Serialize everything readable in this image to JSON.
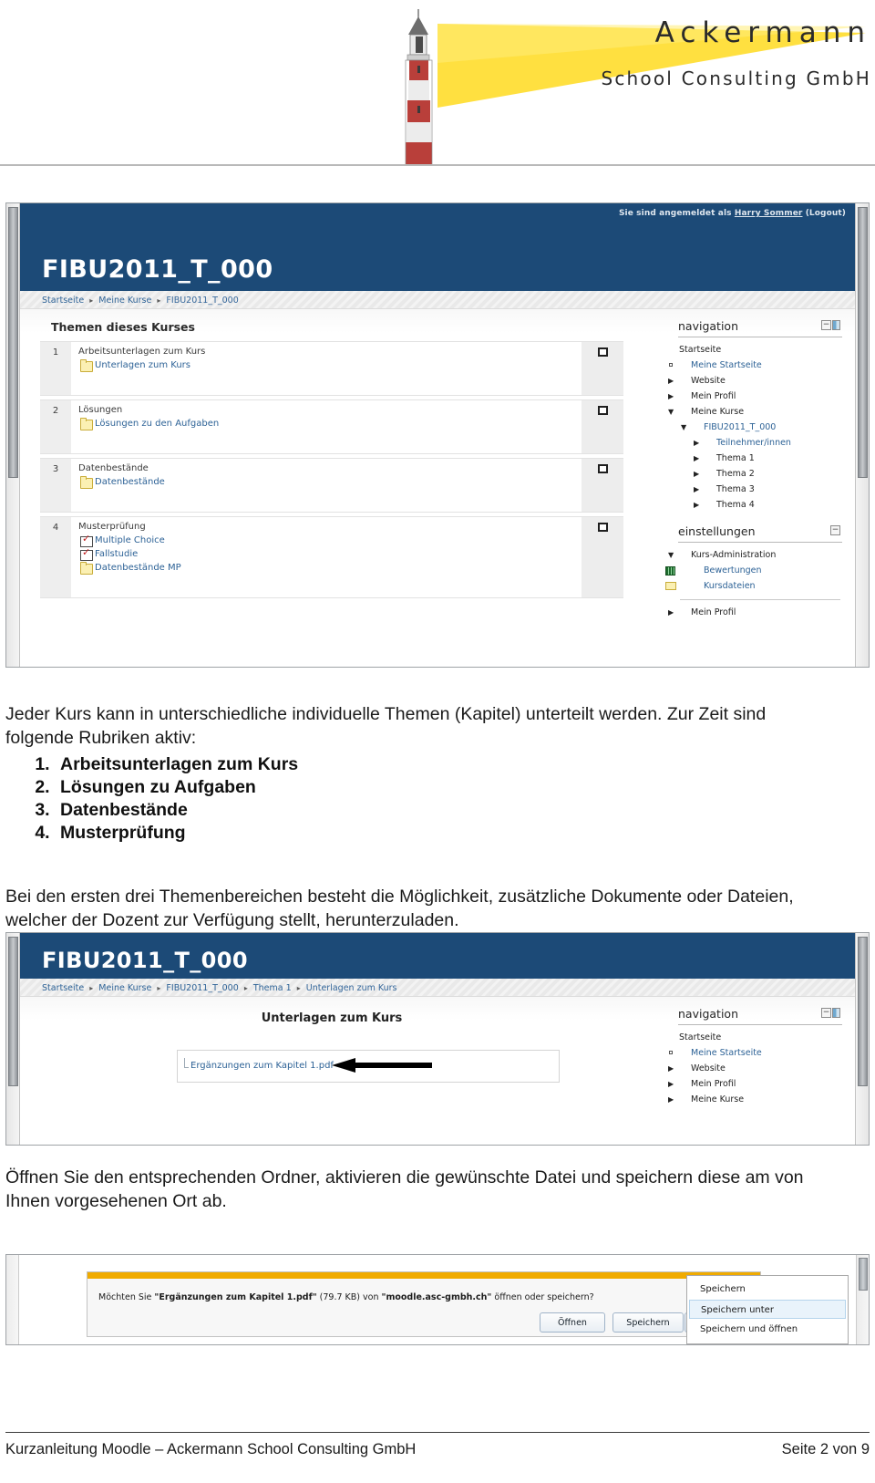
{
  "letterhead": {
    "company_name": "Ackermann",
    "company_sub": "School Consulting GmbH",
    "logo_icon": "lighthouse-icon"
  },
  "screenshot_1": {
    "login_prefix": "Sie sind angemeldet als",
    "login_user": "Harry Sommer",
    "logout_label": "(Logout)",
    "course_title": "FIBU2011_T_000",
    "breadcrumb": [
      "Startseite",
      "Meine Kurse",
      "FIBU2011_T_000"
    ],
    "topics_heading": "Themen dieses Kurses",
    "topics": [
      {
        "number": "1",
        "name": "Arbeitsunterlagen zum Kurs",
        "resources": [
          {
            "label": "Unterlagen zum Kurs",
            "icon": "folder-icon"
          }
        ]
      },
      {
        "number": "2",
        "name": "Lösungen",
        "resources": [
          {
            "label": "Lösungen zu den Aufgaben",
            "icon": "folder-icon"
          }
        ]
      },
      {
        "number": "3",
        "name": "Datenbestände",
        "resources": [
          {
            "label": "Datenbestände",
            "icon": "folder-icon"
          }
        ]
      },
      {
        "number": "4",
        "name": "Musterprüfung",
        "resources": [
          {
            "label": "Multiple Choice",
            "icon": "quiz-icon"
          },
          {
            "label": "Fallstudie",
            "icon": "quiz-icon"
          },
          {
            "label": "Datenbestände MP",
            "icon": "folder-icon"
          }
        ]
      }
    ],
    "nav_block": {
      "title": "navigation",
      "collapse_icon": "minus-icon",
      "dock_icon": "dock-icon",
      "items": [
        {
          "label": "Startseite",
          "level": 0,
          "marker": "none"
        },
        {
          "label": "Meine Startseite",
          "level": 1,
          "marker": "square"
        },
        {
          "label": "Website",
          "level": 1,
          "marker": "collapsed"
        },
        {
          "label": "Mein Profil",
          "level": 1,
          "marker": "collapsed"
        },
        {
          "label": "Meine Kurse",
          "level": 1,
          "marker": "expanded"
        },
        {
          "label": "FIBU2011_T_000",
          "level": 2,
          "marker": "expanded"
        },
        {
          "label": "Teilnehmer/innen",
          "level": 3,
          "marker": "collapsed"
        },
        {
          "label": "Thema 1",
          "level": 3,
          "marker": "collapsed"
        },
        {
          "label": "Thema 2",
          "level": 3,
          "marker": "collapsed"
        },
        {
          "label": "Thema 3",
          "level": 3,
          "marker": "collapsed"
        },
        {
          "label": "Thema 4",
          "level": 3,
          "marker": "collapsed"
        }
      ]
    },
    "settings_block": {
      "title": "einstellungen",
      "collapse_icon": "minus-icon",
      "items": [
        {
          "label": "Kurs-Administration",
          "level": 1,
          "marker": "expanded",
          "icon": "none"
        },
        {
          "label": "Bewertungen",
          "level": 2,
          "marker": "none",
          "icon": "grades-icon"
        },
        {
          "label": "Kursdateien",
          "level": 2,
          "marker": "none",
          "icon": "folder-icon"
        }
      ],
      "after_divider": {
        "label": "Mein Profil",
        "level": 1,
        "marker": "collapsed"
      }
    }
  },
  "body_text": {
    "para1": "Jeder Kurs kann in unterschiedliche individuelle Themen (Kapitel) unterteilt werden. Zur Zeit sind folgende Rubriken aktiv:",
    "list": [
      "Arbeitsunterlagen zum Kurs",
      "Lösungen zu Aufgaben",
      "Datenbestände",
      "Musterprüfung"
    ],
    "para2": "Bei den ersten drei Themenbereichen besteht die Möglichkeit, zusätzliche Dokumente oder Dateien, welcher der Dozent zur Verfügung stellt, herunterzuladen.",
    "para3": "Öffnen Sie den entsprechenden Ordner, aktivieren die gewünschte Datei und speichern diese am von Ihnen vorgesehenen Ort ab."
  },
  "screenshot_2": {
    "course_title": "FIBU2011_T_000",
    "breadcrumb": [
      "Startseite",
      "Meine Kurse",
      "FIBU2011_T_000",
      "Thema 1",
      "Unterlagen zum Kurs"
    ],
    "resource_heading": "Unterlagen zum Kurs",
    "file_link": "Ergänzungen zum Kapitel 1.pdf",
    "arrow_icon": "left-arrow-annotation",
    "nav_block": {
      "title": "navigation",
      "collapse_icon": "minus-icon",
      "dock_icon": "dock-icon",
      "items": [
        {
          "label": "Startseite",
          "level": 0,
          "marker": "none"
        },
        {
          "label": "Meine Startseite",
          "level": 1,
          "marker": "square"
        },
        {
          "label": "Website",
          "level": 1,
          "marker": "collapsed"
        },
        {
          "label": "Mein Profil",
          "level": 1,
          "marker": "collapsed"
        },
        {
          "label": "Meine Kurse",
          "level": 1,
          "marker": "collapsed"
        }
      ]
    }
  },
  "download_dialog": {
    "message_prefix": "Möchten Sie ",
    "filename": "\"Ergänzungen zum Kapitel 1.pdf\"",
    "size": " (79.7 KB) von ",
    "host": "\"moodle.asc-gmbh.ch\"",
    "message_suffix": " öffnen oder speichern?",
    "open_button": "Öffnen",
    "save_button": "Speichern",
    "caret_icon": "chevron-down-icon",
    "menu_items": [
      "Speichern",
      "Speichern unter",
      "Speichern und öffnen"
    ],
    "menu_highlighted": "Speichern unter"
  },
  "footer": {
    "left": "Kurzanleitung Moodle – Ackermann School Consulting GmbH",
    "right": "Seite 2 von 9"
  },
  "colors": {
    "moodle_header_blue": "#1c4a77",
    "link_blue": "#2d6296",
    "gold_bar": "#f0ab00",
    "lighthouse_red": "#b93f3a",
    "beam_yellow": "#ffd600"
  }
}
